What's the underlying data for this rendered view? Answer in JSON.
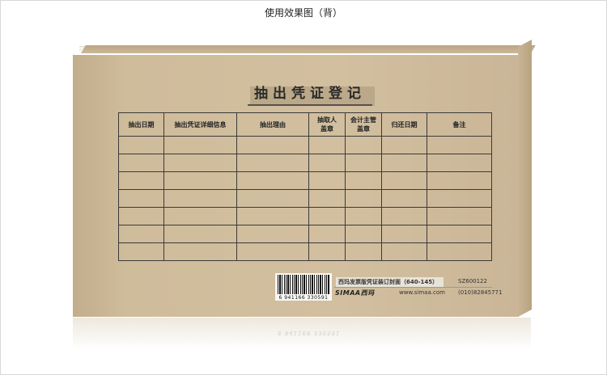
{
  "caption": "使用效果图（背）",
  "form_title": "抽出凭证登记",
  "table": {
    "headers": [
      "抽出日期",
      "抽出凭证详细信息",
      "抽出理由",
      "抽取人\n盖章",
      "会计主管\n盖章",
      "归还日期",
      "备注"
    ],
    "row_count": 7
  },
  "label": {
    "product": "西玛发票版凭证装订封面（640-145）",
    "code": "SZ600122",
    "brand": "SIMAA西玛",
    "website": "www.simaa.com",
    "phone": "(010)82845771",
    "barcode_number": "6 941166 330591"
  },
  "colors": {
    "cover": "#d2bf9f",
    "frame_border": "#d8d8d8"
  }
}
